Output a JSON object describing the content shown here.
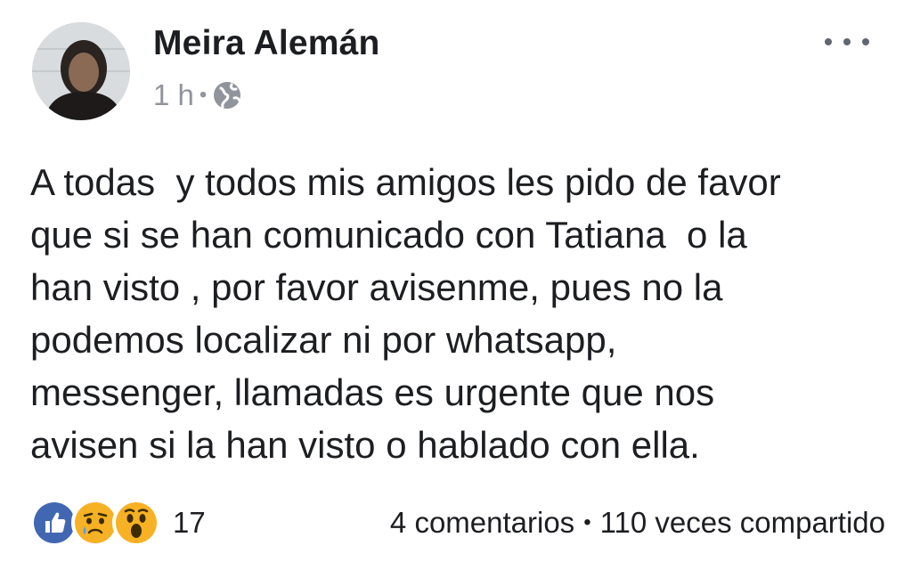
{
  "post": {
    "author": "Meira Alemán",
    "time": "1 h",
    "separator": "•",
    "audience_icon": "globe-icon",
    "menu_icon": "more-options-icon",
    "text": "A todas  y todos mis amigos les pido de favor\nque si se han comunicado con Tatiana  o la\nhan visto , por favor avisenme, pues no la\npodemos localizar ni por whatsapp,\nmessenger, llamadas es urgente que nos\navisen si la han visto o hablado con ella."
  },
  "footer": {
    "reactions": [
      "like-icon",
      "sad-icon",
      "wow-icon"
    ],
    "reaction_count": "17",
    "comments": "4 comentarios",
    "dot": "•",
    "shares": "110 veces compartido"
  },
  "colors": {
    "like": "#4267b2",
    "emoji": "#f7b125",
    "muted": "#90949c"
  }
}
